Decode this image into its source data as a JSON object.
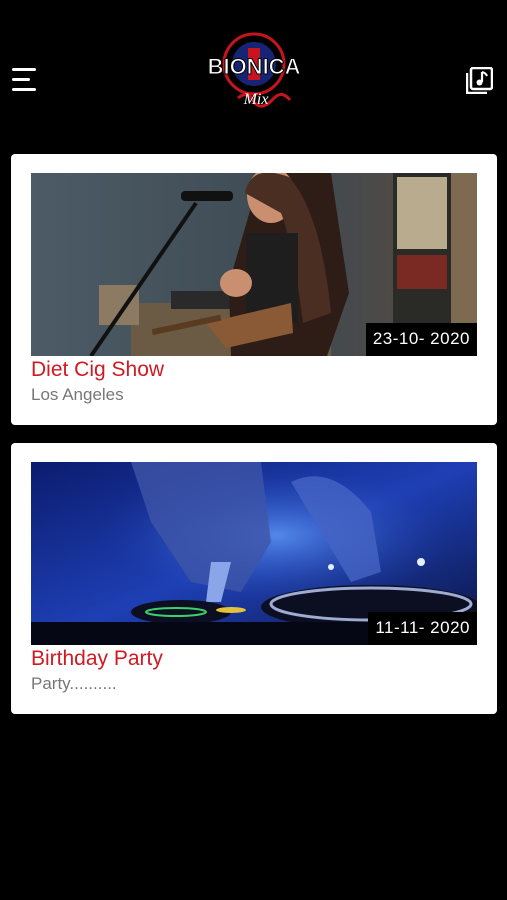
{
  "header": {
    "logo_text": "BIONICA",
    "logo_sub": "Mix",
    "menu_icon": "hamburger-menu-icon",
    "music_icon": "music-library-icon"
  },
  "events": [
    {
      "title": "Diet Cig Show",
      "subtitle": "Los Angeles",
      "date": "23-10- 2020",
      "image": "guitar-performer-photo"
    },
    {
      "title": "Birthday Party",
      "subtitle": "Party..........",
      "date": "11-11- 2020",
      "image": "dj-turntable-photo"
    }
  ],
  "colors": {
    "background": "#000000",
    "title_red": "#d01a22",
    "subtitle_gray": "#777777"
  }
}
